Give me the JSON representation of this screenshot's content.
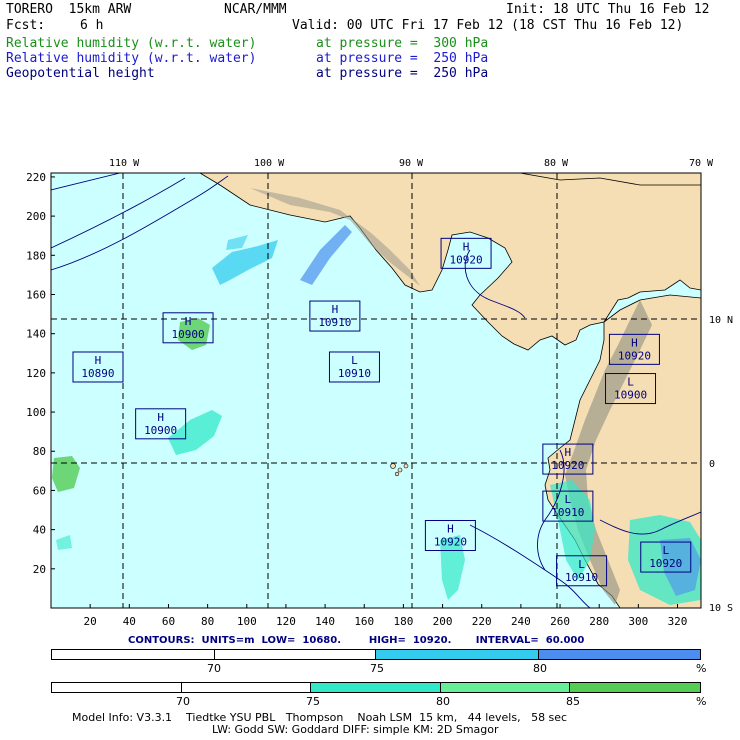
{
  "header": {
    "model": "TORERO  15km ARW",
    "org": "NCAR/MMM",
    "init": "Init: 18 UTC Thu 16 Feb 12",
    "fcst_label": "Fcst:",
    "fcst_value": "6 h",
    "valid": "Valid: 00 UTC Fri 17 Feb 12 (18 CST Thu 16 Feb 12)"
  },
  "fields": [
    {
      "name": "Relative humidity (w.r.t. water)",
      "level": "at pressure =  300 hPa",
      "color": "#1a8f1a"
    },
    {
      "name": "Relative humidity (w.r.t. water)",
      "level": "at pressure =  250 hPa",
      "color": "#1b1bd0"
    },
    {
      "name": "Geopotential height",
      "level": "at pressure =  250 hPa",
      "color": "#000080"
    }
  ],
  "map": {
    "lon_labels": [
      "110 W",
      "100 W",
      "90 W",
      "80 W",
      "70 W"
    ],
    "lat_labels": [
      "10 N",
      "0",
      "10 S"
    ],
    "x_ticks": [
      "20",
      "40",
      "60",
      "80",
      "100",
      "120",
      "140",
      "160",
      "180",
      "200",
      "220",
      "240",
      "260",
      "280",
      "300",
      "320"
    ],
    "y_ticks": [
      "20",
      "40",
      "60",
      "80",
      "100",
      "120",
      "140",
      "160",
      "180",
      "200",
      "220"
    ],
    "pressure_centers": [
      {
        "type": "H",
        "value": "10920",
        "gx": 212,
        "gy": 181
      },
      {
        "type": "H",
        "value": "10900",
        "gx": 70,
        "gy": 143
      },
      {
        "type": "H",
        "value": "10910",
        "gx": 145,
        "gy": 149
      },
      {
        "type": "H",
        "value": "10890",
        "gx": 24,
        "gy": 123
      },
      {
        "type": "L",
        "value": "10910",
        "gx": 155,
        "gy": 123
      },
      {
        "type": "H",
        "value": "10900",
        "gx": 56,
        "gy": 94
      },
      {
        "type": "H",
        "value": "10920",
        "gx": 298,
        "gy": 132
      },
      {
        "type": "L",
        "value": "10900",
        "gx": 296,
        "gy": 112
      },
      {
        "type": "H",
        "value": "10920",
        "gx": 264,
        "gy": 76
      },
      {
        "type": "L",
        "value": "10910",
        "gx": 264,
        "gy": 52
      },
      {
        "type": "H",
        "value": "10920",
        "gx": 204,
        "gy": 37
      },
      {
        "type": "L",
        "value": "10910",
        "gx": 271,
        "gy": 19
      },
      {
        "type": "L",
        "value": "10920",
        "gx": 314,
        "gy": 26
      }
    ]
  },
  "contour_info": {
    "text": "CONTOURS:  UNITS=m  LOW=  10680.        HIGH=  10920.       INTERVAL=  60.000"
  },
  "colorbars": [
    {
      "labels": [
        "70",
        "75",
        "80"
      ],
      "unit": "%",
      "segments": [
        "#ffffff",
        "#ffffff",
        "#33ccee",
        "#4c8ef0"
      ]
    },
    {
      "labels": [
        "70",
        "75",
        "80",
        "85"
      ],
      "unit": "%",
      "segments": [
        "#ffffff",
        "#ffffff",
        "#33e8c8",
        "#66ee99",
        "#55cc55"
      ]
    }
  ],
  "model_info": {
    "line1": "Model Info: V3.3.1    Tiedtke YSU PBL   Thompson    Noah LSM  15 km,   44 levels,   58 sec",
    "line2": "LW: Godd SW: Goddard DIFF: simple KM: 2D Smagor"
  }
}
